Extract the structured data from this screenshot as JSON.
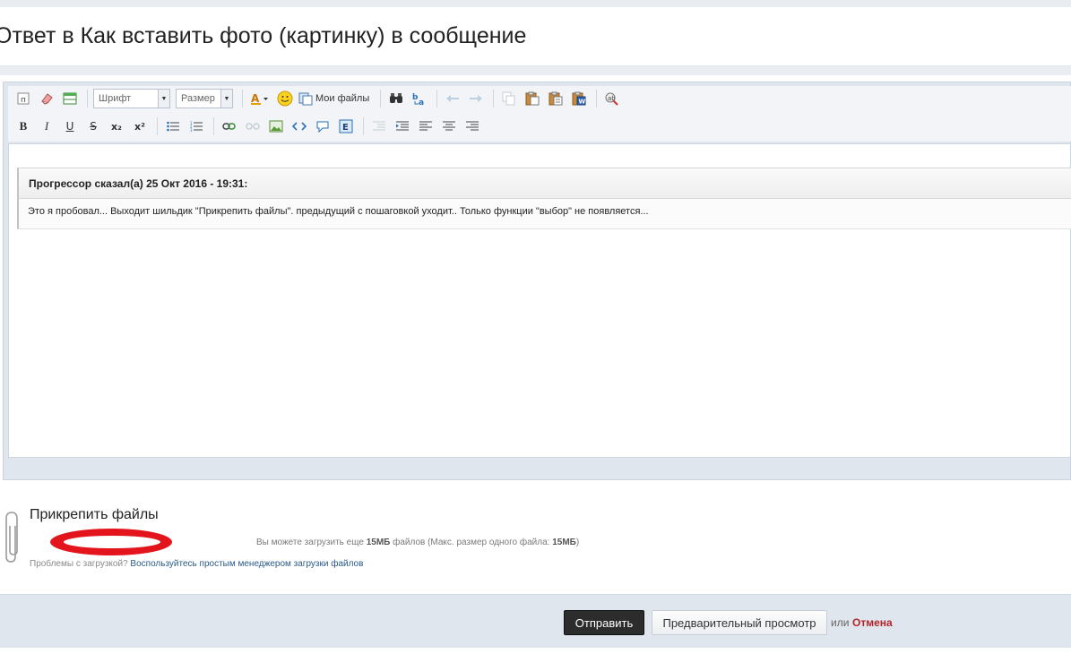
{
  "page": {
    "title": "Ответ в Как вставить фото (картинку) в сообщение"
  },
  "toolbar": {
    "font_select": "Шрифт",
    "size_select": "Размер",
    "my_files": "Мои файлы",
    "row1_icons": [
      "source-icon",
      "eraser-icon",
      "table-icon",
      "font-color-icon",
      "smiley-icon",
      "my-files-icon",
      "find-icon",
      "replace-icon",
      "undo-icon",
      "redo-icon",
      "copy-icon",
      "paste-icon",
      "paste-text-icon",
      "paste-word-icon",
      "spellcheck-icon"
    ],
    "bold": "B",
    "italic": "I",
    "underline": "U",
    "strike": "S",
    "subscript": "x₂",
    "superscript": "x²"
  },
  "editor": {
    "quote_author": "Прогрессор сказал(а) 25 Окт 2016 - 19:31:",
    "quote_text": "Это я пробовал... Выходит шильдик \"Прикрепить файлы\". предыдущий с пошаговкой уходит.. Только функции \"выбор\" не появляется..."
  },
  "attachments": {
    "title": "Прикрепить файлы",
    "info_prefix": "Вы можете загрузить еще",
    "info_amount": "15МБ",
    "info_middle": "файлов (Макс. размер одного файла:",
    "info_max": "15МБ",
    "info_suffix": ")",
    "problems_text": "Проблемы с загрузкой?",
    "problems_link": "Воспользуйтесь простым менеджером загрузки файлов"
  },
  "footer": {
    "send": "Отправить",
    "preview": "Предварительный просмотр",
    "or": "или",
    "cancel": "Отмена"
  },
  "colors": {
    "accent_link": "#2a5a86",
    "cancel": "#b3232a",
    "annotation_red": "#e3141b",
    "frame_bg": "#dfe6ee"
  }
}
